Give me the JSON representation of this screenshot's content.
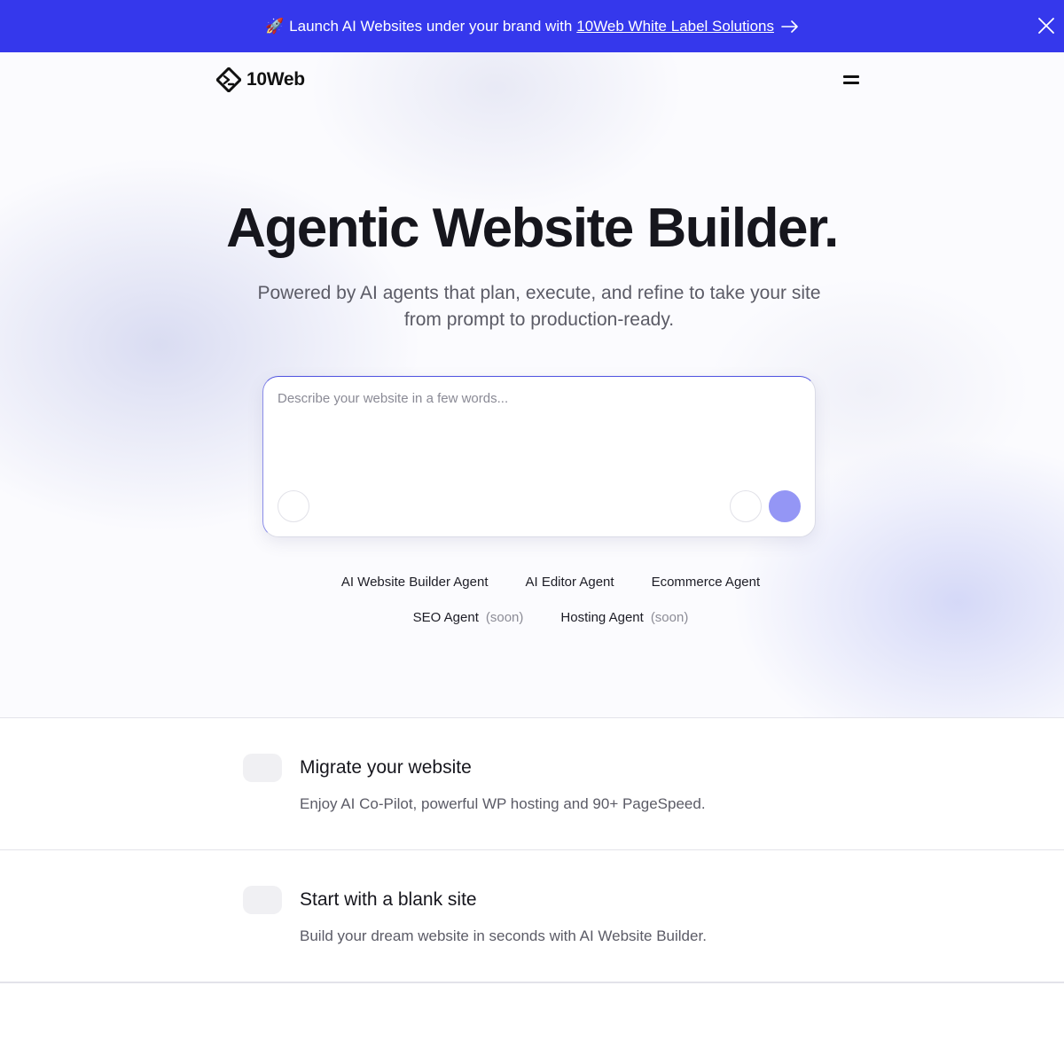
{
  "banner": {
    "rocket": "🚀",
    "text": "Launch AI Websites under your brand with",
    "link_text": "10Web White Label Solutions",
    "close_icon": "close-icon",
    "arrow_icon": "arrow-right-icon",
    "background_color": "#3538ec"
  },
  "nav": {
    "logo_text": "10Web",
    "menu_icon": "hamburger-menu-icon"
  },
  "hero": {
    "title": "Agentic Website Builder.",
    "subtitle": "Powered by AI agents that plan, execute, and refine to take your site from prompt to production-ready."
  },
  "prompt": {
    "placeholder": "Describe your website in a few words...",
    "value": "",
    "send_color": "#9496f5"
  },
  "agents": {
    "row1": [
      {
        "label": "AI Website Builder Agent"
      },
      {
        "label": "AI Editor Agent"
      },
      {
        "label": "Ecommerce Agent"
      }
    ],
    "row2": [
      {
        "label": "SEO Agent",
        "badge": "(soon)"
      },
      {
        "label": "Hosting Agent",
        "badge": "(soon)"
      }
    ]
  },
  "options": [
    {
      "title": "Migrate your website",
      "description": "Enjoy AI Co-Pilot, powerful WP hosting and 90+ PageSpeed."
    },
    {
      "title": "Start with a blank site",
      "description": "Build your dream website in seconds with AI Website Builder."
    }
  ]
}
